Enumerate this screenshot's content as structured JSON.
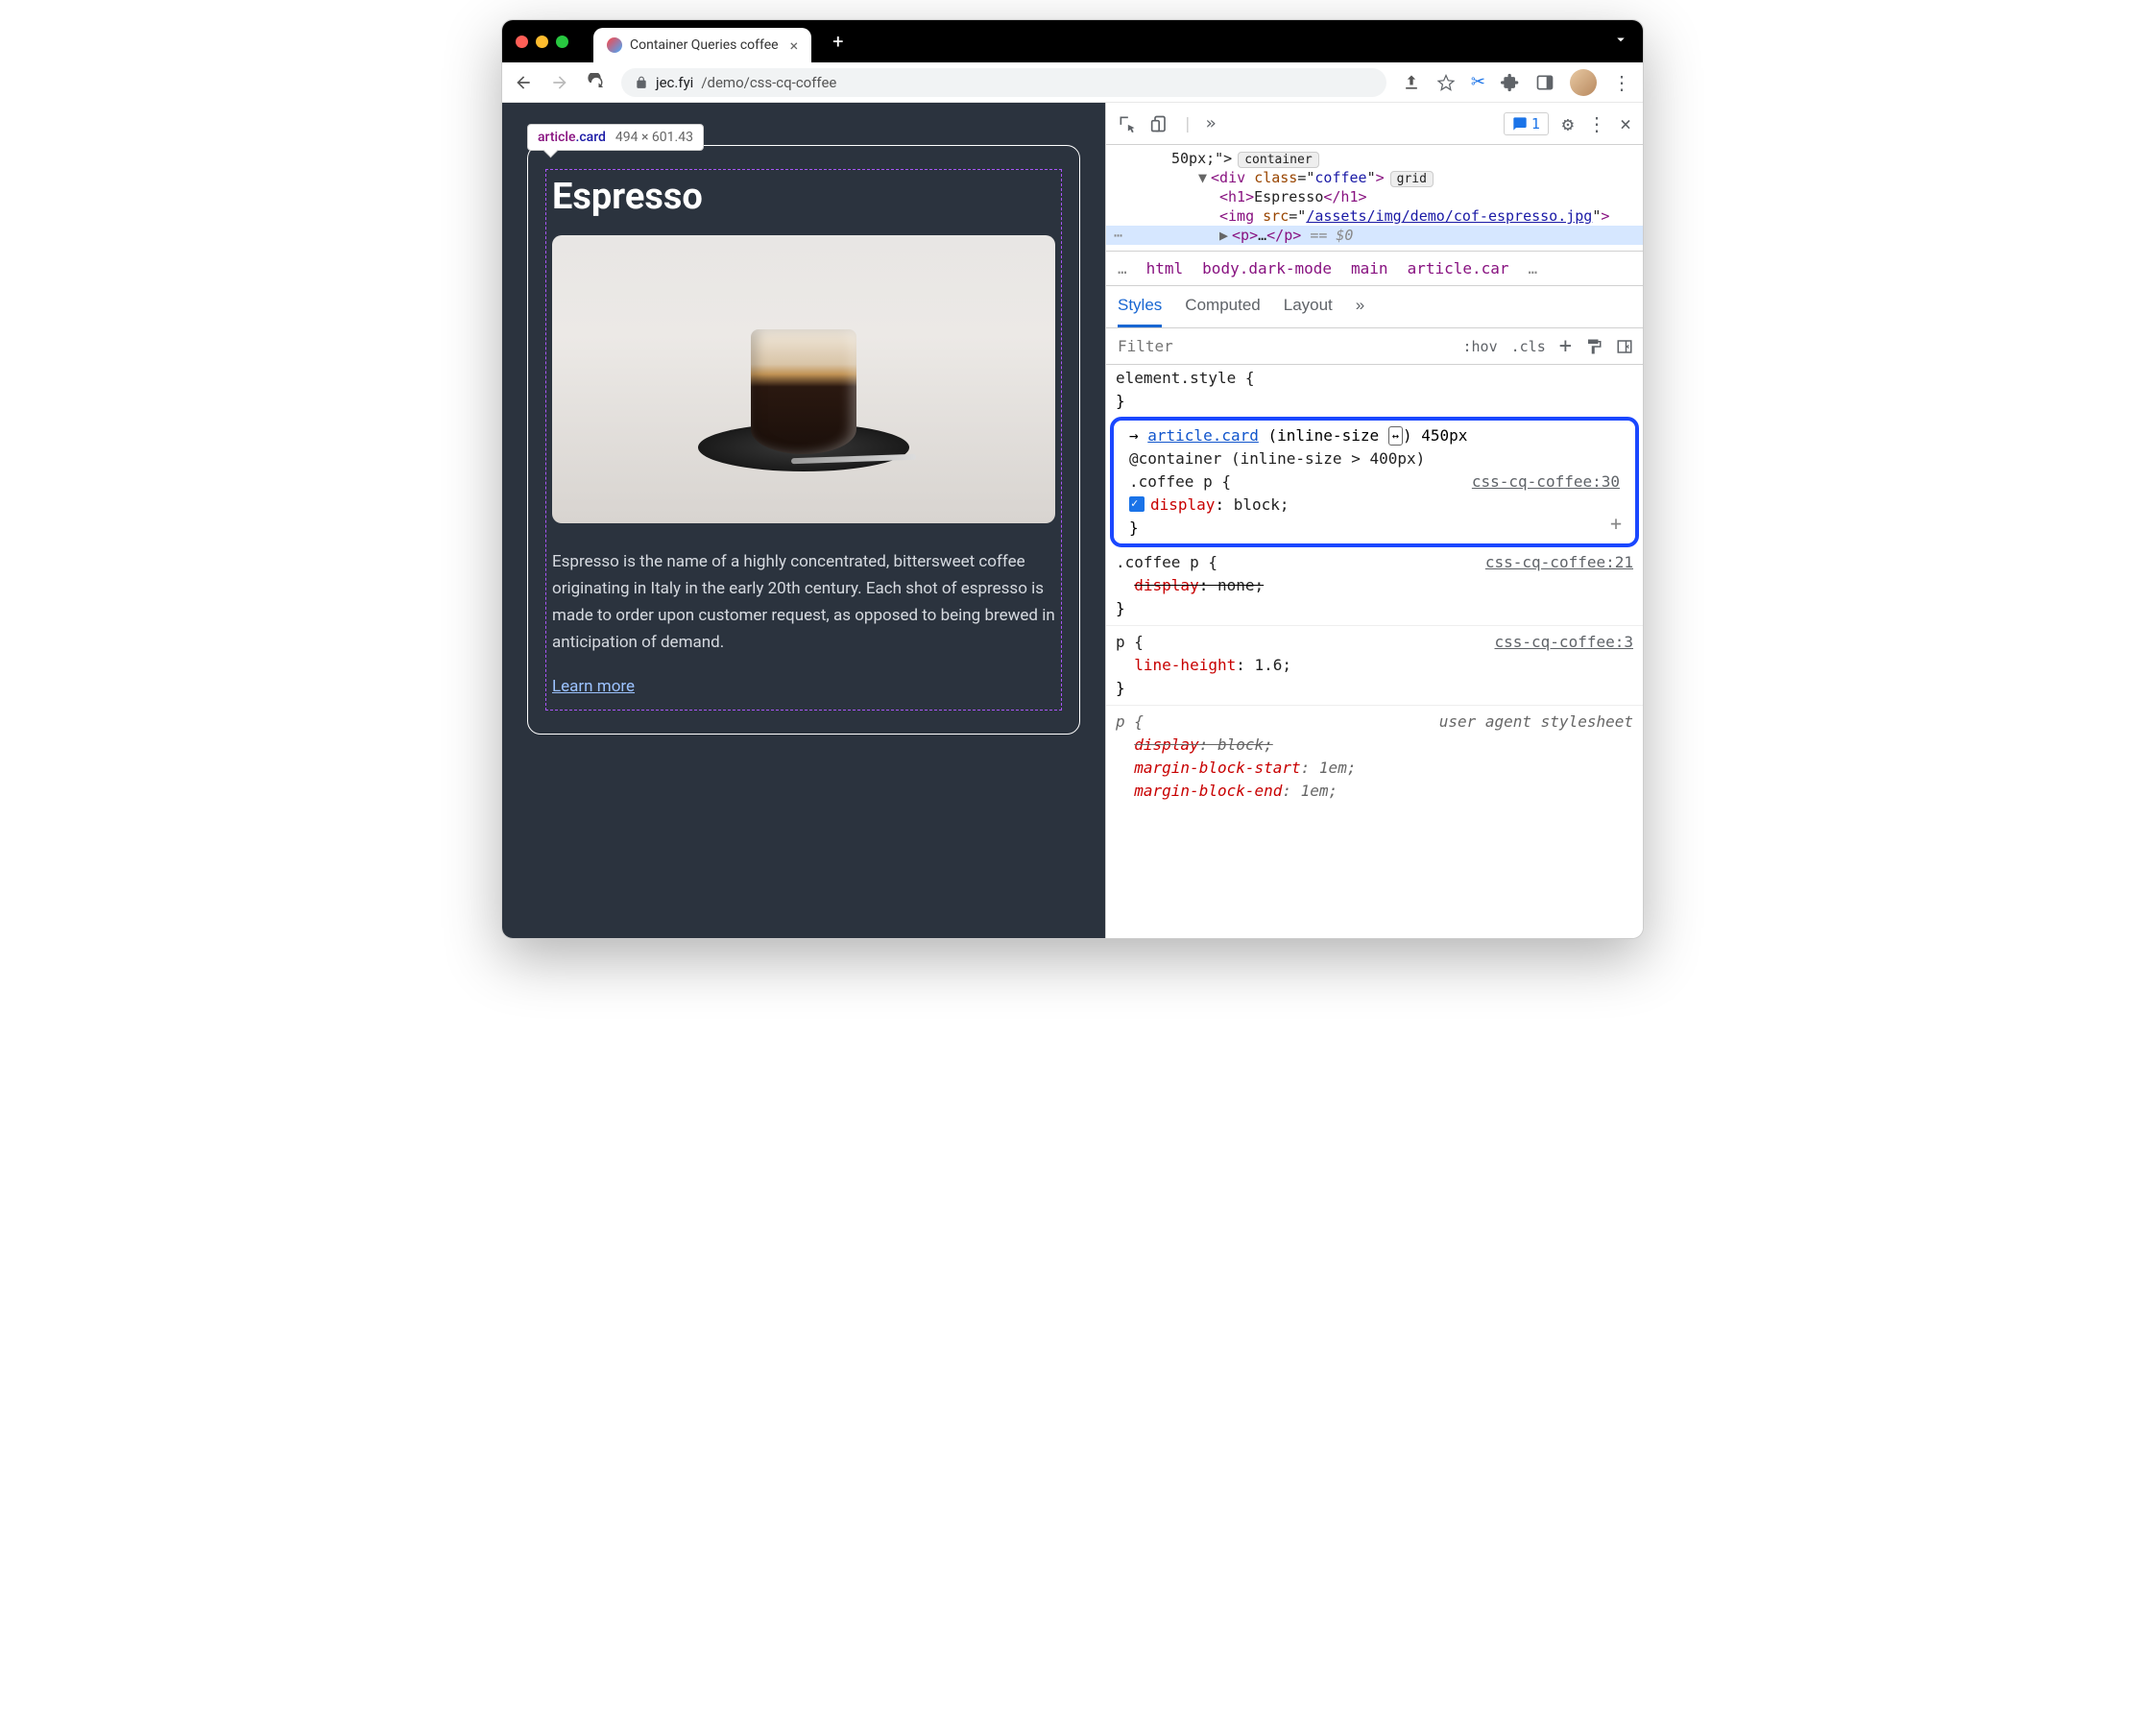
{
  "browser": {
    "tab_title": "Container Queries coffee",
    "url_domain": "jec.fyi",
    "url_path": "/demo/css-cq-coffee"
  },
  "inspect_tooltip": {
    "tag": "article",
    "class": ".card",
    "dimensions": "494 × 601.43"
  },
  "page": {
    "heading": "Espresso",
    "paragraph": "Espresso is the name of a highly concentrated, bittersweet coffee originating in Italy in the early 20th century. Each shot of espresso is made to order upon customer request, as opposed to being brewed in anticipation of demand.",
    "link": "Learn more"
  },
  "devtools": {
    "issue_count": "1",
    "elements": {
      "line1_prefix": "50px;\">",
      "line1_pill": "container",
      "line2_open": "<div class=\"coffee\">",
      "line2_pill": "grid",
      "line3": "<h1>Espresso</h1>",
      "line4_a": "<img src=\"",
      "line4_link": "/assets/img/demo/cof-espresso.jpg",
      "line4_b": "\">",
      "line5": "<p>…</p>",
      "line5_eq": "== $0"
    },
    "breadcrumbs": [
      "…",
      "html",
      "body.dark-mode",
      "main",
      "article.car",
      "…"
    ],
    "styles_tabs": [
      "Styles",
      "Computed",
      "Layout",
      "»"
    ],
    "filter_placeholder": "Filter",
    "filter_buttons": {
      "hov": ":hov",
      "cls": ".cls"
    },
    "rules": {
      "element_style": "element.style {",
      "r1_article": "article.card",
      "r1_inline": "(inline-size",
      "r1_size": "450px",
      "r1_at": "@container (inline-size > 400px)",
      "r1_sel": ".coffee p {",
      "r1_src": "css-cq-coffee:30",
      "r1_prop": "display",
      "r1_val": "block;",
      "r2_sel": ".coffee p {",
      "r2_src": "css-cq-coffee:21",
      "r2_prop": "display",
      "r2_val": "none;",
      "r3_sel": "p {",
      "r3_src": "css-cq-coffee:3",
      "r3_prop": "line-height",
      "r3_val": "1.6;",
      "r4_sel": "p {",
      "r4_src": "user agent stylesheet",
      "r4_p1": "display",
      "r4_v1": "block;",
      "r4_p2": "margin-block-start",
      "r4_v2": "1em;",
      "r4_p3": "margin-block-end",
      "r4_v3": "1em;"
    }
  }
}
